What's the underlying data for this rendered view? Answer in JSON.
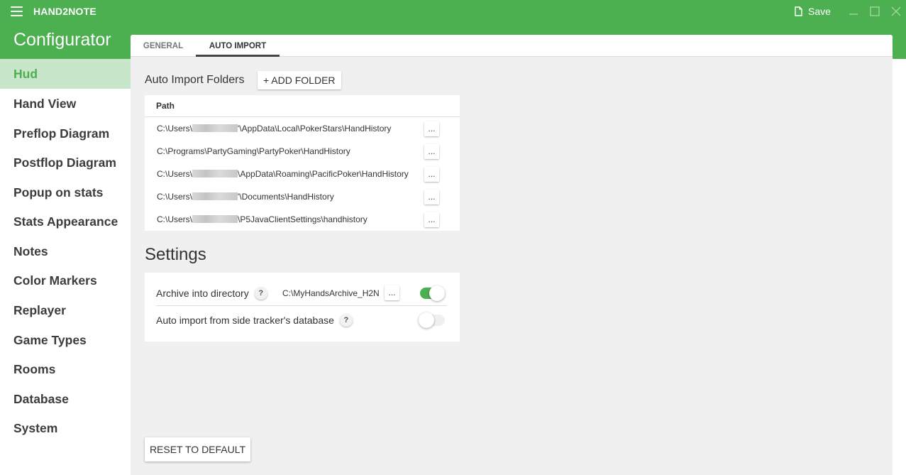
{
  "app": {
    "title": "HAND2NOTE",
    "save_label": "Save"
  },
  "header": {
    "title": "Configurator"
  },
  "sidebar": {
    "items": [
      {
        "label": "Hud",
        "active": true
      },
      {
        "label": "Hand View"
      },
      {
        "label": "Preflop Diagram"
      },
      {
        "label": "Postflop Diagram"
      },
      {
        "label": "Popup on stats"
      },
      {
        "label": "Stats Appearance"
      },
      {
        "label": "Notes"
      },
      {
        "label": "Color Markers"
      },
      {
        "label": "Replayer"
      },
      {
        "label": "Game Types"
      },
      {
        "label": "Rooms"
      },
      {
        "label": "Database"
      },
      {
        "label": "System"
      }
    ]
  },
  "tabs": [
    {
      "label": "GENERAL"
    },
    {
      "label": "AUTO IMPORT",
      "active": true
    }
  ],
  "auto_import": {
    "label": "Auto Import Folders",
    "add_button": "+ ADD FOLDER",
    "column_header": "Path",
    "rows": [
      {
        "prefix": "C:\\Users\\",
        "redacted": true,
        "suffix": "'\\AppData\\Local\\PokerStars\\HandHistory",
        "button": "..."
      },
      {
        "prefix": "C:\\Programs\\PartyGaming\\PartyPoker\\HandHistory",
        "redacted": false,
        "suffix": "",
        "button": "..."
      },
      {
        "prefix": "C:\\Users\\",
        "redacted": true,
        "suffix": "\\AppData\\Roaming\\PacificPoker\\HandHistory",
        "button": "..."
      },
      {
        "prefix": "C:\\Users\\",
        "redacted": true,
        "suffix": "'\\Documents\\HandHistory",
        "button": "..."
      },
      {
        "prefix": "C:\\Users\\",
        "redacted": true,
        "suffix": "\\P5JavaClientSettings\\handhistory",
        "button": "..."
      }
    ]
  },
  "settings": {
    "title": "Settings",
    "archive": {
      "label": "Archive into directory",
      "help": "?",
      "path": "C:\\MyHandsArchive_H2N",
      "button": "...",
      "enabled": true
    },
    "side_tracker": {
      "label": "Auto import from side tracker's database",
      "help": "?",
      "enabled": false
    }
  },
  "reset_button": "RESET TO DEFAULT",
  "colors": {
    "accent": "#4caf50",
    "active_bg": "#c8e6c9",
    "content_bg": "#f0f0f0"
  }
}
